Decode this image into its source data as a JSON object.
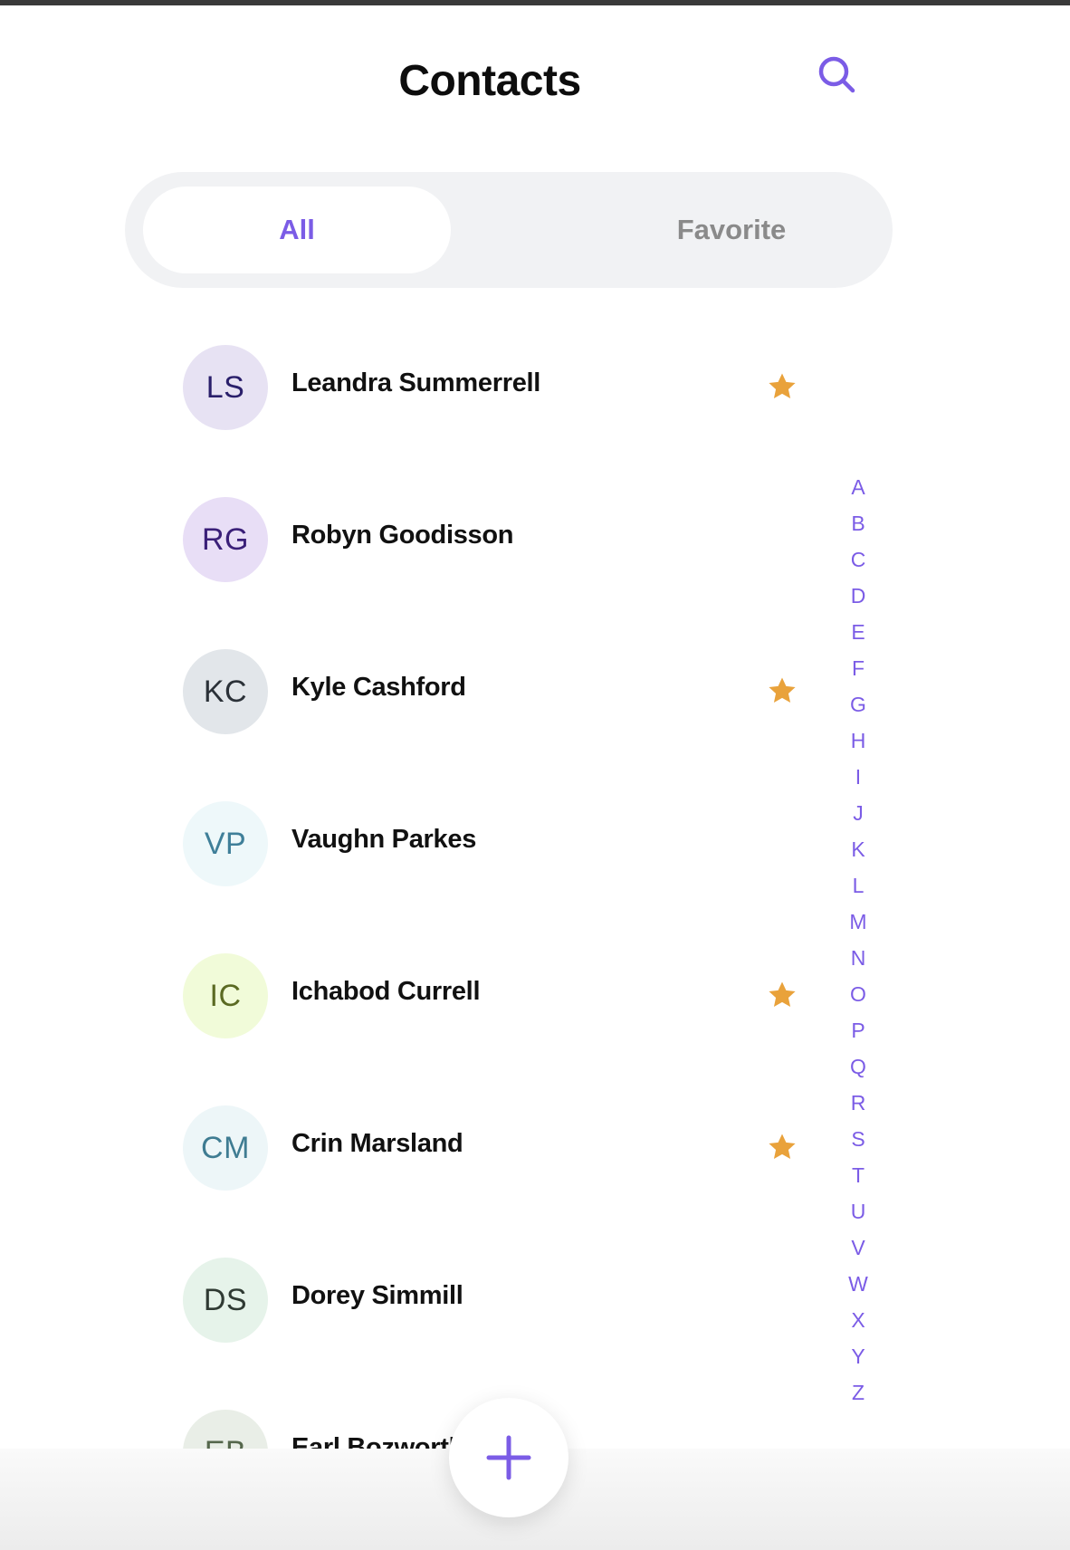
{
  "header": {
    "title": "Contacts",
    "search_icon": "search-icon"
  },
  "tabs": [
    {
      "label": "All",
      "selected": true
    },
    {
      "label": "Favorite",
      "selected": false
    }
  ],
  "colors": {
    "accent": "#7b5ce6",
    "star": "#e9a23b",
    "tab_track": "#f1f2f4"
  },
  "contacts": [
    {
      "initials": "LS",
      "name": "Leandra Summerrell",
      "favorite": true,
      "avatar_bg": "#e7e2f3",
      "avatar_fg": "#2a1f6b"
    },
    {
      "initials": "RG",
      "name": "Robyn Goodisson",
      "favorite": false,
      "avatar_bg": "#e8def6",
      "avatar_fg": "#3a1f78"
    },
    {
      "initials": "KC",
      "name": "Kyle Cashford",
      "favorite": true,
      "avatar_bg": "#e2e6ea",
      "avatar_fg": "#2b3138"
    },
    {
      "initials": "VP",
      "name": "Vaughn Parkes",
      "favorite": false,
      "avatar_bg": "#eef8fa",
      "avatar_fg": "#3f7f99"
    },
    {
      "initials": "IC",
      "name": "Ichabod Currell",
      "favorite": true,
      "avatar_bg": "#f1fbd9",
      "avatar_fg": "#5b6a23"
    },
    {
      "initials": "CM",
      "name": "Crin Marsland",
      "favorite": true,
      "avatar_bg": "#edf6f8",
      "avatar_fg": "#3f7c92"
    },
    {
      "initials": "DS",
      "name": "Dorey Simmill",
      "favorite": false,
      "avatar_bg": "#e6f3ea",
      "avatar_fg": "#2f3a33"
    },
    {
      "initials": "EB",
      "name": "Earl Bozworth",
      "favorite": false,
      "avatar_bg": "#e9eee7",
      "avatar_fg": "#55674c"
    }
  ],
  "alphabet": [
    "A",
    "B",
    "C",
    "D",
    "E",
    "F",
    "G",
    "H",
    "I",
    "J",
    "K",
    "L",
    "M",
    "N",
    "O",
    "P",
    "Q",
    "R",
    "S",
    "T",
    "U",
    "V",
    "W",
    "X",
    "Y",
    "Z"
  ],
  "fab": {
    "icon": "plus-icon"
  }
}
